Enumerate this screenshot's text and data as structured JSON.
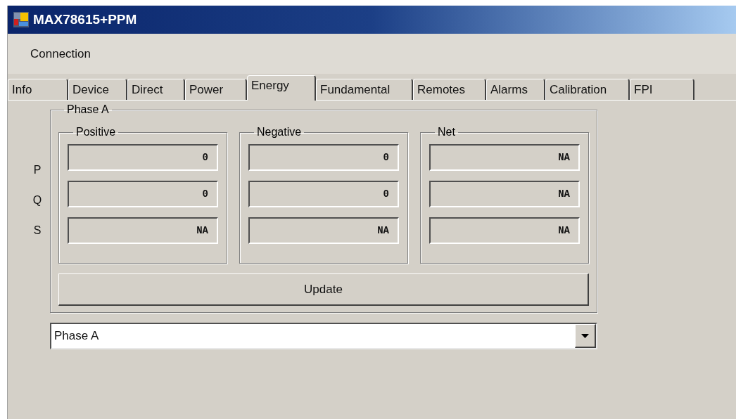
{
  "window": {
    "title": "MAX78615+PPM"
  },
  "menu": [
    {
      "label": "Connection"
    }
  ],
  "tabs": [
    {
      "label": "Info",
      "selected": false
    },
    {
      "label": "Device",
      "selected": false
    },
    {
      "label": "Direct",
      "selected": false
    },
    {
      "label": "Power",
      "selected": false
    },
    {
      "label": "Energy",
      "selected": true
    },
    {
      "label": "Fundamental",
      "selected": false
    },
    {
      "label": "Remotes",
      "selected": false
    },
    {
      "label": "Alarms",
      "selected": false
    },
    {
      "label": "Calibration",
      "selected": false
    },
    {
      "label": "FPI",
      "selected": false
    }
  ],
  "row_labels": [
    "P",
    "Q",
    "S"
  ],
  "phase_group": {
    "title": "Phase A",
    "columns": [
      {
        "title": "Positive",
        "values": [
          "0",
          "0",
          "NA"
        ]
      },
      {
        "title": "Negative",
        "values": [
          "0",
          "0",
          "NA"
        ]
      },
      {
        "title": "Net",
        "values": [
          "NA",
          "NA",
          "NA"
        ]
      }
    ],
    "button": "Update"
  },
  "phase_select": {
    "value": "Phase A"
  }
}
